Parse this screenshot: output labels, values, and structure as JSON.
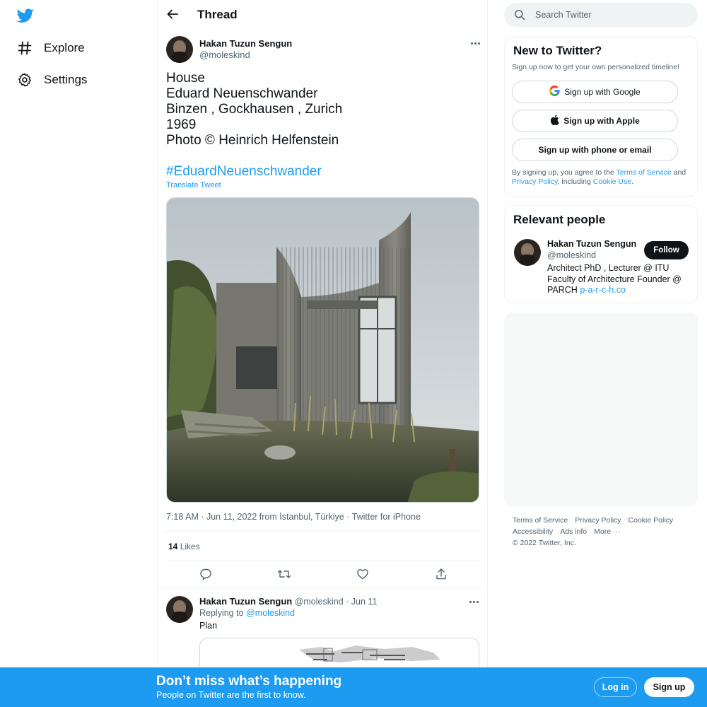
{
  "nav": {
    "logo_icon": "twitter-bird-icon",
    "items": [
      {
        "label": "Explore",
        "icon": "hashtag-icon"
      },
      {
        "label": "Settings",
        "icon": "gear-icon"
      }
    ]
  },
  "thread": {
    "title": "Thread",
    "tweet": {
      "author_name": "Hakan Tuzun Sengun",
      "author_handle": "@moleskind",
      "lines": [
        "House",
        "Eduard Neuenschwander",
        "Binzen , Gockhausen , Zurich",
        "1969",
        "Photo © Heinrich Helfenstein"
      ],
      "hashtag": "#EduardNeuenschwander",
      "translate_label": "Translate Tweet",
      "meta": "7:18 AM · Jun 11, 2022 from İstanbul, Türkiye · Twitter for iPhone",
      "likes_count": "14",
      "likes_label": "Likes"
    },
    "reply": {
      "author_name": "Hakan Tuzun Sengun",
      "author_handle": "@moleskind",
      "date": "· Jun 11",
      "replying_prefix": "Replying to",
      "replying_to": "@moleskind",
      "text": "Plan"
    }
  },
  "search": {
    "placeholder": "Search Twitter"
  },
  "new_to_twitter": {
    "title": "New to Twitter?",
    "subtitle": "Sign up now to get your own personalized timeline!",
    "google_label": "Sign up with Google",
    "apple_label": "Sign up with Apple",
    "phone_label": "Sign up with phone or email",
    "legal_prefix": "By signing up, you agree to the",
    "terms": "Terms of Service",
    "and": "and",
    "privacy": "Privacy Policy",
    "including": ", including",
    "cookie": "Cookie Use",
    "period": "."
  },
  "relevant_people": {
    "title": "Relevant people",
    "name": "Hakan Tuzun Sengun",
    "handle": "@moleskind",
    "follow_label": "Follow",
    "bio": "Architect PhD , Lecturer @ ITU Faculty of Architecture Founder @ PARCH",
    "bio_link": "p-a-r-c-h.co"
  },
  "footer": {
    "links": [
      "Terms of Service",
      "Privacy Policy",
      "Cookie Policy",
      "Accessibility",
      "Ads info",
      "More ···"
    ],
    "copyright": "© 2022 Twitter, Inc."
  },
  "bottom_bar": {
    "title": "Don’t miss what’s happening",
    "subtitle": "People on Twitter are the first to know.",
    "login_label": "Log in",
    "signup_label": "Sign up"
  },
  "colors": {
    "accent": "#1d9bf0",
    "text": "#0f1419",
    "muted": "#536471"
  }
}
